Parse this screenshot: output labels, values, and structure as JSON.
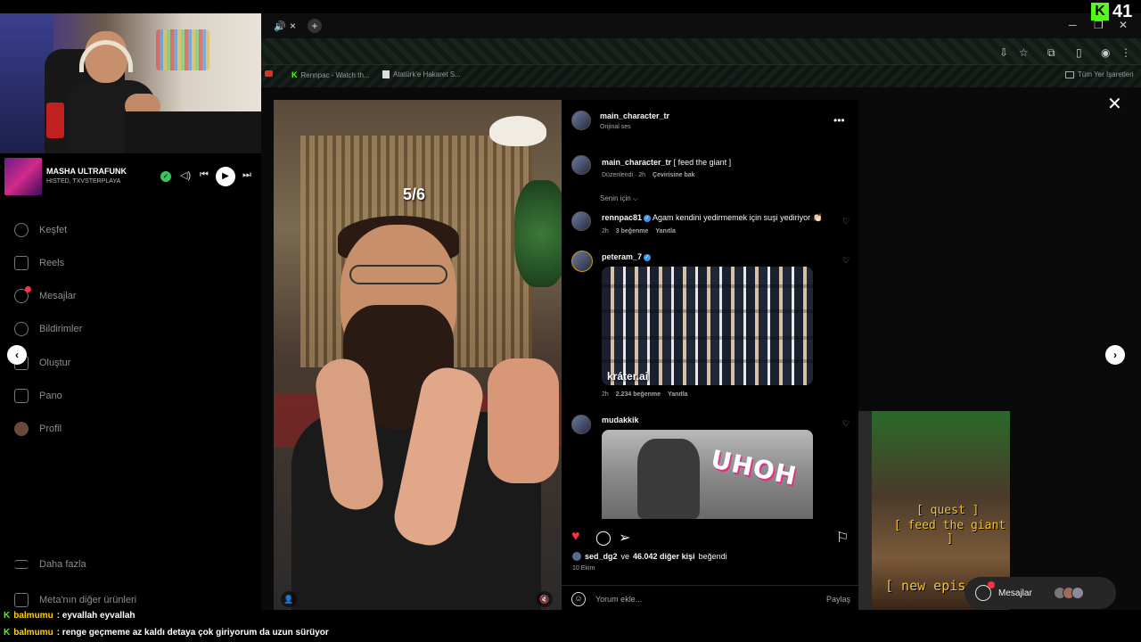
{
  "kick": {
    "logo_letter": "K",
    "viewer_count": "41"
  },
  "browser": {
    "tab_close": "×",
    "tab_new": "+",
    "bookmarks": [
      {
        "label": "Rennpac - Watch th..."
      },
      {
        "label": "Atatürk'e Hakaret S..."
      }
    ],
    "all_bookmarks": "Tüm Yer İşaretleri"
  },
  "music": {
    "title": "MASHA ULTRAFUNK",
    "artist": "HISTED, TXVSTERPLAYA"
  },
  "sidebar": {
    "items": [
      {
        "label": "Keşfet"
      },
      {
        "label": "Reels"
      },
      {
        "label": "Mesajlar"
      },
      {
        "label": "Bildirimler"
      },
      {
        "label": "Oluştur"
      },
      {
        "label": "Pano"
      },
      {
        "label": "Profil"
      },
      {
        "label": "Daha fazla"
      },
      {
        "label": "Meta'nın diğer ürünleri"
      }
    ]
  },
  "video": {
    "counter": "5/6"
  },
  "post": {
    "author": "main_character_tr",
    "author_sub": "Orijinal ses",
    "caption_user": "main_character_tr",
    "caption_text": "[ feed the giant ]",
    "caption_meta_edited": "Düzenlendi · 2h",
    "caption_meta_translate": "Çevirisine bak",
    "sort_label": "Senin için",
    "comments": [
      {
        "user": "rennpac81",
        "text": "Agam kendini yedirmemek için suşi yediriyor 👏🏻",
        "time": "2h",
        "likes": "3 beğenme",
        "reply": "Yanıtla"
      },
      {
        "user": "peteram_7",
        "time": "2h",
        "likes": "2.234 beğenme",
        "reply": "Yanıtla",
        "gif_watermark": "kráter.ai"
      },
      {
        "user": "mudakkik",
        "gif_text": "UHOH"
      }
    ],
    "liked_by_user": "sed_dg2",
    "liked_by_conj": "ve",
    "liked_by_others": "46.042 diğer kişi",
    "liked_by_suffix": "beğendi",
    "date": "10 Ekim",
    "comment_placeholder": "Yorum ekle...",
    "share_label": "Paylaş"
  },
  "thumbnail": {
    "line1": "[ quest ]",
    "line2": "[ feed the giant ]",
    "line3": "[ new episo"
  },
  "messages_pill": {
    "label": "Mesajlar"
  },
  "chat": [
    {
      "badge": "K",
      "user": "balmumu",
      "text": ": eyvallah eyvallah"
    },
    {
      "badge": "K",
      "user": "balmumu",
      "text": ": renge geçmeme az kaldı detaya çok giriyorum da uzun sürüyor"
    }
  ]
}
